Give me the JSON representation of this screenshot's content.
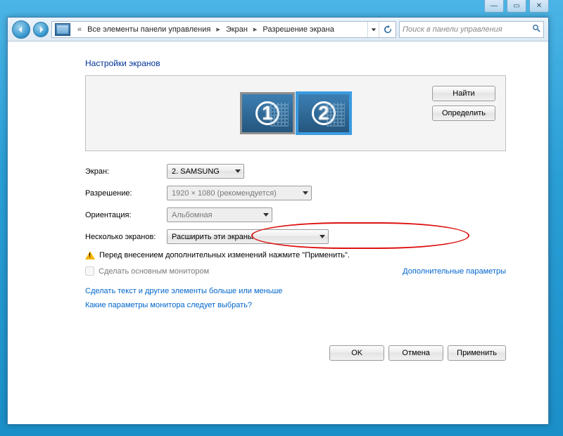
{
  "titlebar": {
    "min": "—",
    "max": "▭",
    "close": "✕"
  },
  "breadcrumb": {
    "prefix": "«",
    "items": [
      "Все элементы панели управления",
      "Экран",
      "Разрешение экрана"
    ]
  },
  "search": {
    "placeholder": "Поиск в панели управления"
  },
  "page": {
    "title": "Настройки экранов"
  },
  "preview": {
    "monitors": [
      {
        "num": "1"
      },
      {
        "num": "2"
      }
    ],
    "find_btn": "Найти",
    "identify_btn": "Определить"
  },
  "form": {
    "screen_label": "Экран:",
    "screen_value": "2. SAMSUNG",
    "resolution_label": "Разрешение:",
    "resolution_value": "1920 × 1080 (рекомендуется)",
    "orientation_label": "Ориентация:",
    "orientation_value": "Альбомная",
    "multi_label": "Несколько экранов:",
    "multi_value": "Расширить эти экраны"
  },
  "warning": "Перед внесением дополнительных изменений нажмите \"Применить\".",
  "checkbox": {
    "label": "Сделать основным монитором",
    "advanced": "Дополнительные параметры"
  },
  "links": {
    "textsize": "Сделать текст и другие элементы больше или меньше",
    "whichparams": "Какие параметры монитора следует выбрать?"
  },
  "footer": {
    "ok": "OK",
    "cancel": "Отмена",
    "apply": "Применить"
  }
}
